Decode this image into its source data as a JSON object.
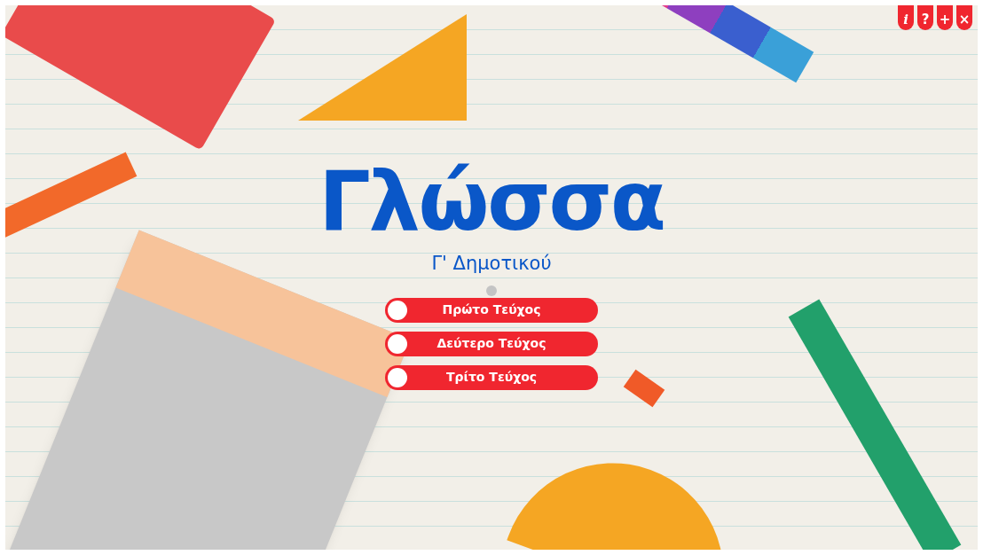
{
  "top_buttons": [
    {
      "kind": "info",
      "label": "i"
    },
    {
      "kind": "help",
      "label": "?"
    },
    {
      "kind": "zoom",
      "label": "+"
    },
    {
      "kind": "close",
      "label": "×"
    }
  ],
  "title": "Γλώσσα",
  "subtitle": "Γ' Δημοτικού",
  "menu": [
    {
      "label": "Πρώτο Τεύχος",
      "selected": false
    },
    {
      "label": "Δεύτερο Τεύχος",
      "selected": false
    },
    {
      "label": "Τρίτο Τεύχος",
      "selected": false
    }
  ]
}
